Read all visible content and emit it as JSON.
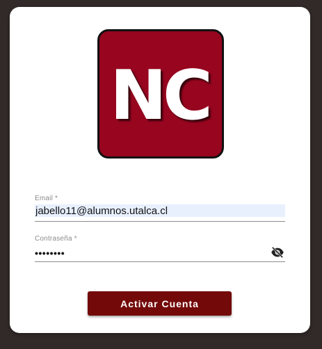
{
  "logo": {
    "text": "NC",
    "background_color": "#97051f",
    "text_color": "#ffffff"
  },
  "email": {
    "label": "Email *",
    "value": "jabello11@alumnos.utalca.cl",
    "autofill_color": "#e8f0fe"
  },
  "password": {
    "label": "Contraseña *",
    "masked_value": "••••••••",
    "toggle_icon": "eye-off-icon"
  },
  "submit": {
    "label": "Activar Cuenta",
    "color": "#730909"
  }
}
